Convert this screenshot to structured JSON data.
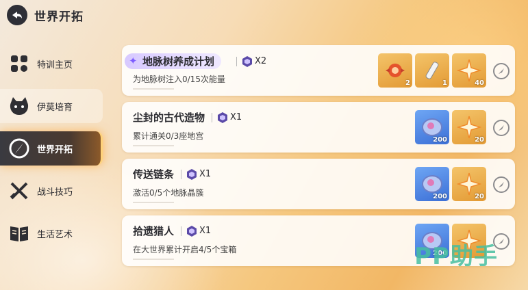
{
  "header": {
    "title": "世界开拓"
  },
  "sidebar": {
    "items": [
      {
        "label": "特训主页",
        "icon": "grid-icon"
      },
      {
        "label": "伊莫培育",
        "icon": "creature-icon"
      },
      {
        "label": "世界开拓",
        "icon": "compass-icon",
        "active": true
      },
      {
        "label": "战斗技巧",
        "icon": "crossed-swords-icon"
      },
      {
        "label": "生活艺术",
        "icon": "book-icon"
      }
    ]
  },
  "quests": [
    {
      "title": "地脉树养成计划",
      "multiplier": "X2",
      "desc": "为地脉树注入0/15次能量",
      "rewards": [
        {
          "icon": "orb-icon",
          "qty": "2",
          "bg": "gold"
        },
        {
          "icon": "scroll-icon",
          "qty": "1",
          "bg": "gold"
        },
        {
          "icon": "star-icon",
          "qty": "40",
          "bg": "gold"
        }
      ]
    },
    {
      "title": "尘封的古代造物",
      "multiplier": "X1",
      "desc": "累计通关0/3座地宫",
      "rewards": [
        {
          "icon": "coin-icon",
          "qty": "200",
          "bg": "blue"
        },
        {
          "icon": "star-icon",
          "qty": "20",
          "bg": "gold"
        }
      ]
    },
    {
      "title": "传送链条",
      "multiplier": "X1",
      "desc": "激活0/5个地脉晶簇",
      "rewards": [
        {
          "icon": "coin-icon",
          "qty": "200",
          "bg": "blue"
        },
        {
          "icon": "star-icon",
          "qty": "20",
          "bg": "gold"
        }
      ]
    },
    {
      "title": "拾遗猎人",
      "multiplier": "X1",
      "desc": "在大世界累计开启4/5个宝箱",
      "rewards": [
        {
          "icon": "coin-icon",
          "qty": "200",
          "bg": "blue"
        },
        {
          "icon": "star-icon",
          "qty": "",
          "bg": "gold"
        }
      ]
    }
  ],
  "watermark": "PP助手",
  "colors": {
    "accent": "#ffd27a",
    "active_bg": "#3a3a40",
    "highlight": "#d7c9ff"
  }
}
